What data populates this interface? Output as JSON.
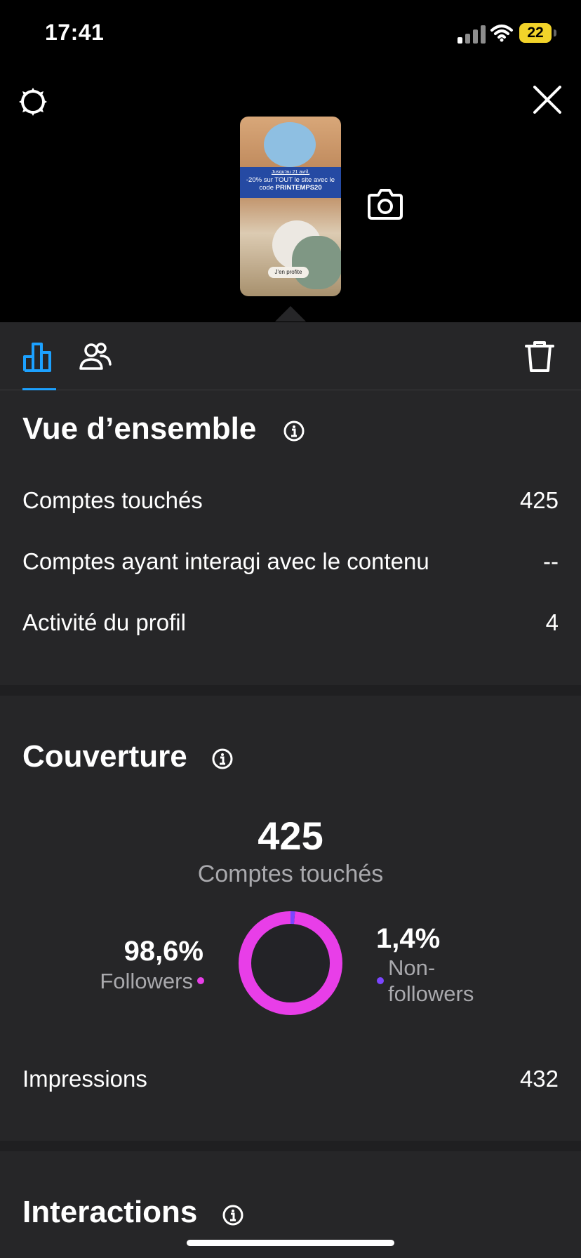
{
  "status_bar": {
    "time": "17:41",
    "battery": "22"
  },
  "top": {
    "story_preview": {
      "promo_small": "Jusqu'au 21 avril,",
      "promo_line1": "-20% sur TOUT le site avec le",
      "promo_line2": "code",
      "promo_code": "PRINTEMPS20",
      "cta": "J'en profite"
    }
  },
  "icons": {
    "settings": "gear-icon",
    "close": "close-icon",
    "camera": "camera-icon",
    "chart_tab": "bar-chart-icon",
    "audience_tab": "people-icon",
    "delete": "trash-icon",
    "info": "info-icon"
  },
  "overview": {
    "title": "Vue d’ensemble",
    "rows": [
      {
        "label": "Comptes touchés",
        "value": "425"
      },
      {
        "label": "Comptes ayant interagi avec le contenu",
        "value": "--"
      },
      {
        "label": "Activité du profil",
        "value": "4"
      }
    ]
  },
  "coverage": {
    "title": "Couverture",
    "total": "425",
    "total_label": "Comptes touchés",
    "followers_pct": "98,6%",
    "followers_label": "Followers",
    "non_followers_pct": "1,4%",
    "non_followers_label_1": "Non-",
    "non_followers_label_2": "followers",
    "followers_share": 0.986,
    "non_followers_share": 0.014,
    "impressions_label": "Impressions",
    "impressions_value": "432"
  },
  "interactions": {
    "title": "Interactions"
  },
  "colors": {
    "accent": "#1ca1ff",
    "followers": "#e83ee8",
    "non_followers": "#7b45ff",
    "background": "#262628"
  }
}
